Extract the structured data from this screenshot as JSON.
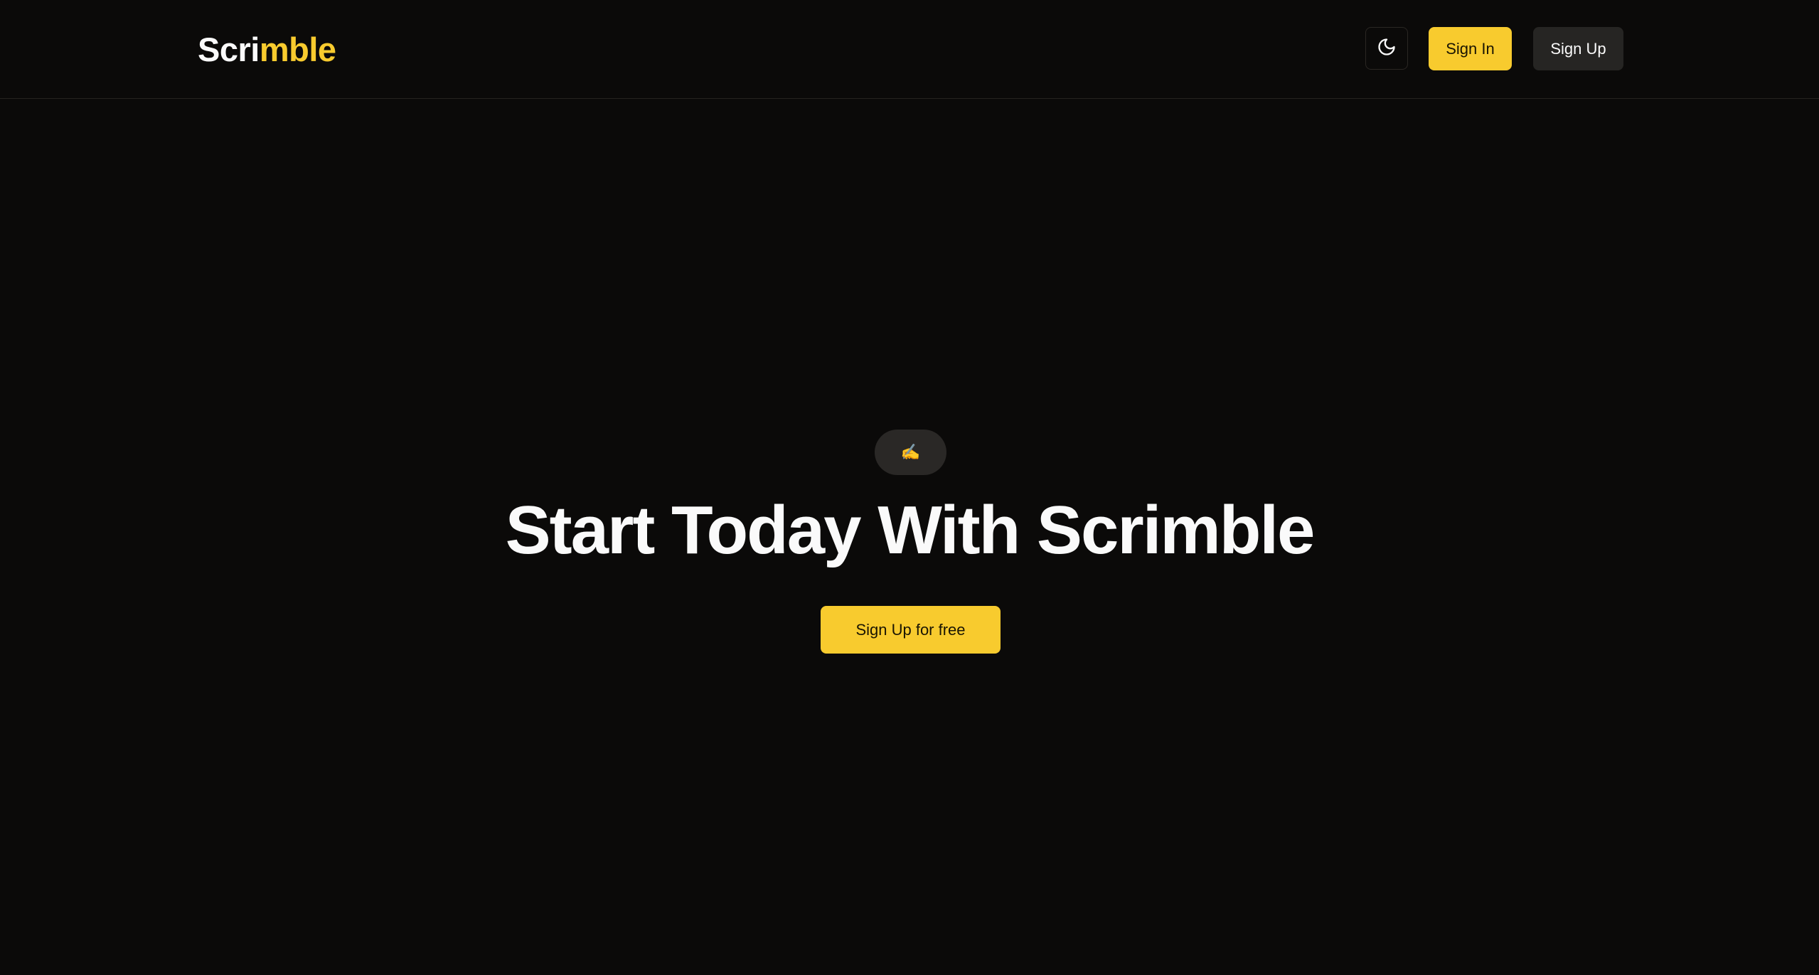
{
  "header": {
    "logo_part1": "Scri",
    "logo_part2": "mble",
    "theme_toggle_icon": "moon-icon",
    "sign_in_label": "Sign In",
    "sign_up_label": "Sign Up"
  },
  "hero": {
    "badge_emoji": "✍️",
    "title": "Start Today With Scrimble",
    "cta_label": "Sign Up for free"
  },
  "colors": {
    "background": "#0b0a09",
    "accent": "#f8cb2e",
    "secondary_button": "#262523",
    "text": "#fafafa"
  }
}
